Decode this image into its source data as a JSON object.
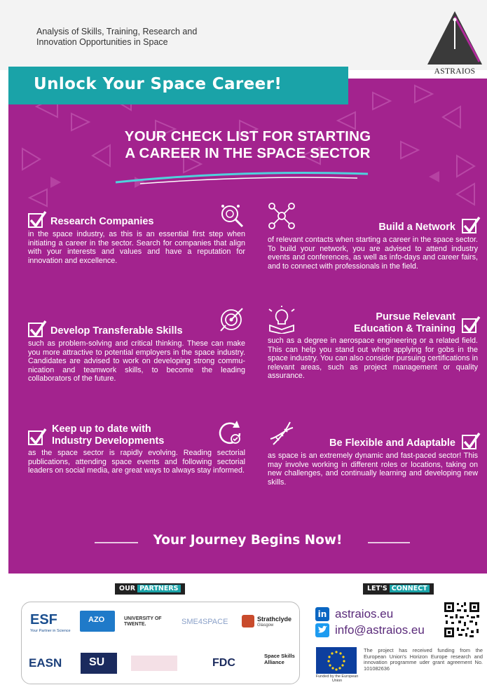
{
  "header": {
    "subtitle_line1": "Analysis of Skills, Training, Research and",
    "subtitle_line2": "Innovation Opportunities in Space",
    "brand": "ASTRAIOS"
  },
  "banner": "Unlock Your Space Career!",
  "heading": {
    "line1": "YOUR CHECK LIST FOR STARTING",
    "line2": "A CAREER IN THE SPACE SECTOR"
  },
  "items": [
    {
      "title": "Research Companies",
      "body": "in the space industry, as this is an essential first step when initiating a career in the sector. Search for companies that align with your interests and values and have a reputation for innovation and excellence."
    },
    {
      "title": "Build a Network",
      "body": "of relevant contacts when starting a career in the space sector. To build your network, you are advised to attend industry events and conferences, as well as info-days and career fairs, and to connect with professionals in the field."
    },
    {
      "title": "Develop Transferable Skills",
      "body": "such as problem-solving and critical thinking. These can make you more attractive to potential employers in the space industry. Candidates are advised to work on developing strong commu-nication and teamwork skills, to become the leading collaborators of the future."
    },
    {
      "title_line1": "Pursue Relevant",
      "title_line2": "Education & Training",
      "body": "such as a degree in aerospace engineering or a related field. This can help you stand out when applying for gobs in the space industry. You can also consider pursuing certifications in relevant areas, such as project management or quality assurance."
    },
    {
      "title_line1": "Keep up to date with",
      "title_line2": "Industry Developments",
      "body": "as the space sector is rapidly evolving. Reading sectorial publications, attending space events and following sectorial leaders on social media, are great ways to always stay informed."
    },
    {
      "title": "Be Flexible and Adaptable",
      "body": "as space is an extremely dynamic and fast-paced sector! This may involve working in different roles or locations, taking on new challenges, and continually learning and developing new skills."
    }
  ],
  "closing": "Your Journey Begins Now!",
  "footer": {
    "partners_tag_a": "OUR",
    "partners_tag_b": "PARTNERS",
    "connect_tag_a": "LET'S",
    "connect_tag_b": "CONNECT",
    "partner_logos": [
      "ESF",
      "Your Partner in Science",
      "AZO",
      "UNIVERSITY OF TWENTE.",
      "SME4SPACE",
      "Strathclyde",
      "Glasgow",
      "EASN",
      "SU",
      "FDC",
      "Space Skills Alliance"
    ],
    "website": "astraios.eu",
    "email": "info@astraios.eu",
    "eu_caption": "Funded by the European Union",
    "funding": "The project has received funding from the European Union's Horizon Europe research and innovation programme uder grant agreement No. 101082636"
  },
  "colors": {
    "magenta": "#a3238e",
    "teal": "#1aa3a8",
    "white": "#ffffff"
  },
  "icons": [
    "magnifier-icon",
    "network-icon",
    "target-icon",
    "lightbulb-book-icon",
    "refresh-icon",
    "dna-icon",
    "checkbox-icon",
    "linkedin-icon",
    "twitter-icon",
    "qr-code",
    "eu-flag"
  ]
}
